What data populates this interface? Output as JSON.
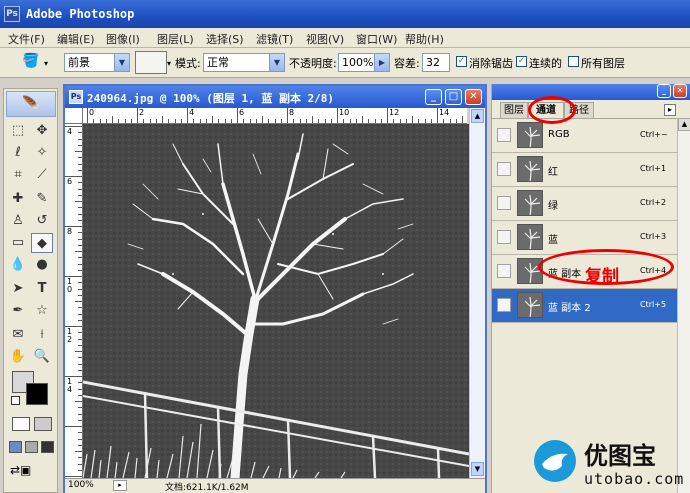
{
  "app": {
    "title": "Adobe Photoshop",
    "logo_text": "Ps"
  },
  "menu": [
    {
      "label": "文件(F)"
    },
    {
      "label": "编辑(E)"
    },
    {
      "label": "图像(I)"
    },
    {
      "label": "图层(L)"
    },
    {
      "label": "选择(S)"
    },
    {
      "label": "滤镜(T)"
    },
    {
      "label": "视图(V)"
    },
    {
      "label": "窗口(W)"
    },
    {
      "label": "帮助(H)"
    }
  ],
  "options": {
    "fill_source": "前景",
    "mode_label": "模式:",
    "mode_value": "正常",
    "opacity_label": "不透明度:",
    "opacity_value": "100%",
    "tolerance_label": "容差:",
    "tolerance_value": "32",
    "antialias_label": "消除锯齿",
    "antialias_checked": true,
    "contiguous_label": "连续的",
    "contiguous_checked": true,
    "all_layers_label": "所有图层",
    "all_layers_checked": false
  },
  "document": {
    "title": "240964.jpg @ 100% (图层 1, 蓝 副本 2/8)",
    "ruler_h": [
      "0",
      "2",
      "4",
      "6",
      "8",
      "10",
      "12",
      "14"
    ],
    "ruler_v": [
      "4",
      "6",
      "8",
      "10",
      "12",
      "14"
    ],
    "zoom": "100%",
    "doc_info": "文档:621.1K/1.62M"
  },
  "panel": {
    "tabs": [
      "图层",
      "通道",
      "路径"
    ],
    "active_tab": "通道",
    "channels": [
      {
        "name": "RGB",
        "shortcut": "Ctrl+~",
        "visible": false,
        "selected": false
      },
      {
        "name": "红",
        "shortcut": "Ctrl+1",
        "visible": false,
        "selected": false
      },
      {
        "name": "绿",
        "shortcut": "Ctrl+2",
        "visible": false,
        "selected": false
      },
      {
        "name": "蓝",
        "shortcut": "Ctrl+3",
        "visible": false,
        "selected": false
      },
      {
        "name": "蓝 副本",
        "shortcut": "Ctrl+4",
        "visible": false,
        "selected": false
      },
      {
        "name": "蓝 副本 2",
        "shortcut": "Ctrl+5",
        "visible": true,
        "selected": true
      }
    ]
  },
  "annotation": {
    "text": "复制",
    "color": "#e00000"
  },
  "watermark": {
    "brand": "优图宝",
    "url": "utobao.com"
  },
  "colors": {
    "titlebar": "#1e50c0",
    "selected_row": "#316ac5",
    "canvas_bg": "#444444"
  }
}
